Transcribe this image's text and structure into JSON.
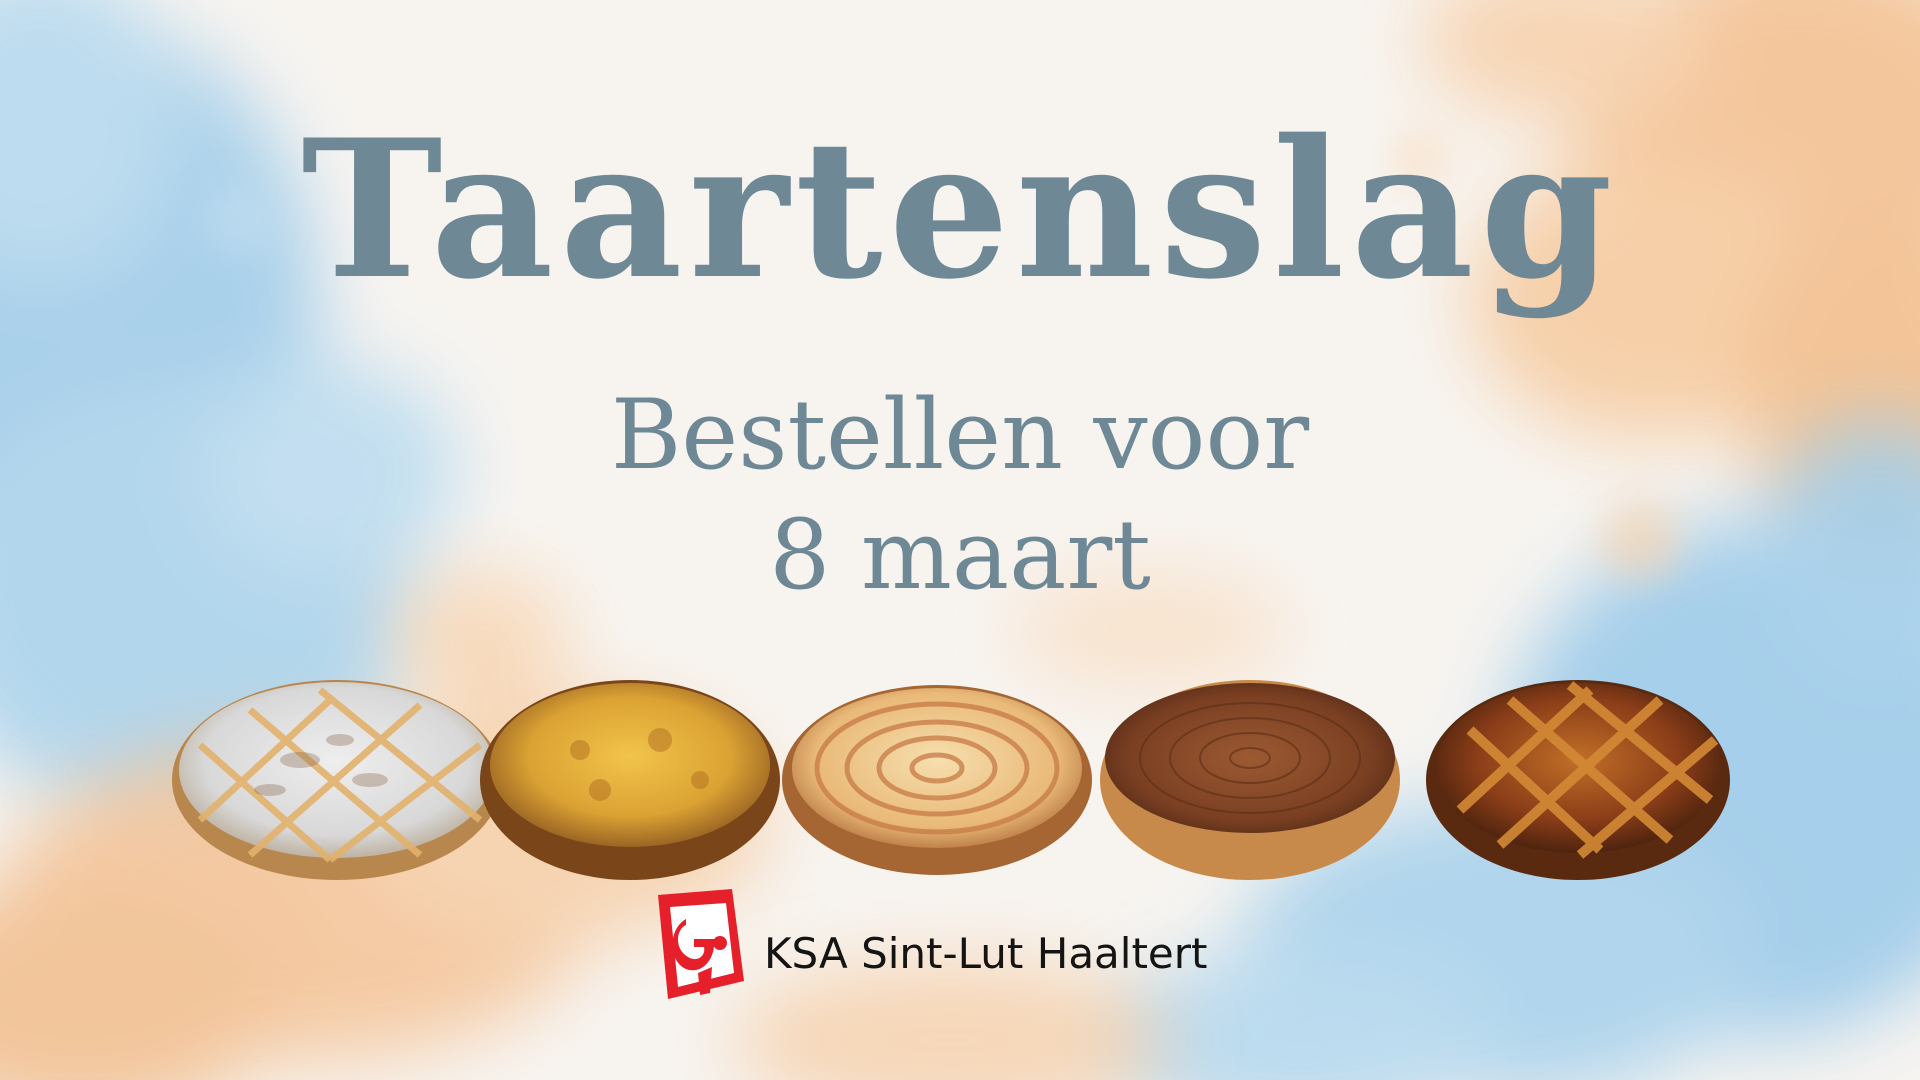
{
  "poster": {
    "title": "Taartenslag",
    "subtitle_line1": "Bestellen voor",
    "subtitle_line2": "8 maart"
  },
  "logo": {
    "text": "KSA Sint-Lut Haaltert",
    "icon": "ksa-logo-icon"
  },
  "pies": [
    {
      "name": "rijsttaart-lattice-pie",
      "icon": "lattice-pie-icon"
    },
    {
      "name": "vlaai-custard-pie",
      "icon": "custard-pie-icon"
    },
    {
      "name": "appeltaart-pie",
      "icon": "apple-pie-icon"
    },
    {
      "name": "chocolate-pie",
      "icon": "chocolate-pie-icon"
    },
    {
      "name": "abrikoos-lattice-pie",
      "icon": "fruit-lattice-pie-icon"
    }
  ],
  "colors": {
    "title": "#6e8896",
    "accent_blue": "#a9d3ee",
    "accent_orange": "#f5c79a",
    "logo_red": "#e5202b"
  }
}
